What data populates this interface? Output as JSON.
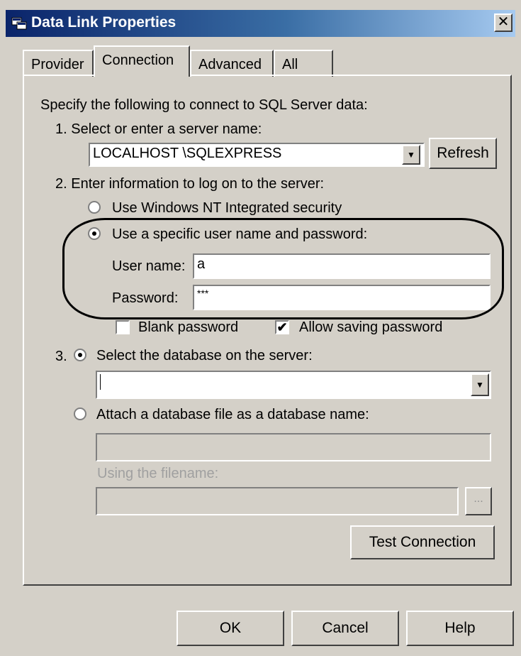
{
  "window": {
    "title": "Data Link Properties",
    "close_label": "✕"
  },
  "tabs": [
    {
      "label": "Provider",
      "active": false
    },
    {
      "label": "Connection",
      "active": true
    },
    {
      "label": "Advanced",
      "active": false
    },
    {
      "label": "All",
      "active": false
    }
  ],
  "connection": {
    "intro": "Specify the following to connect to SQL Server data:",
    "step1_label": "1. Select or enter a server name:",
    "server_name": "LOCALHOST \\SQLEXPRESS",
    "refresh_label": "Refresh",
    "step2_label": "2. Enter information to log on to the server:",
    "auth_options": [
      {
        "label": "Use Windows NT Integrated security",
        "selected": false
      },
      {
        "label": "Use a specific user name and password:",
        "selected": true
      }
    ],
    "username_label": "User name:",
    "username_value": "a",
    "password_label": "Password:",
    "password_value": "***",
    "blank_password_label": "Blank password",
    "blank_password_checked": false,
    "allow_saving_label": "Allow saving password",
    "allow_saving_checked": true,
    "step3_number": "3.",
    "db_options": [
      {
        "label": "Select the database on the server:",
        "selected": true
      },
      {
        "label": "Attach a database file as a database name:",
        "selected": false
      }
    ],
    "database_value": "",
    "attach_name_value": "",
    "filename_label": "Using the filename:",
    "filename_value": "",
    "browse_label": "...",
    "test_connection_label": "Test Connection"
  },
  "footer": {
    "ok_label": "OK",
    "cancel_label": "Cancel",
    "help_label": "Help"
  },
  "colors": {
    "dialog_bg": "#d4d0c8",
    "title_start": "#0a246a",
    "title_end": "#a6caf0"
  }
}
